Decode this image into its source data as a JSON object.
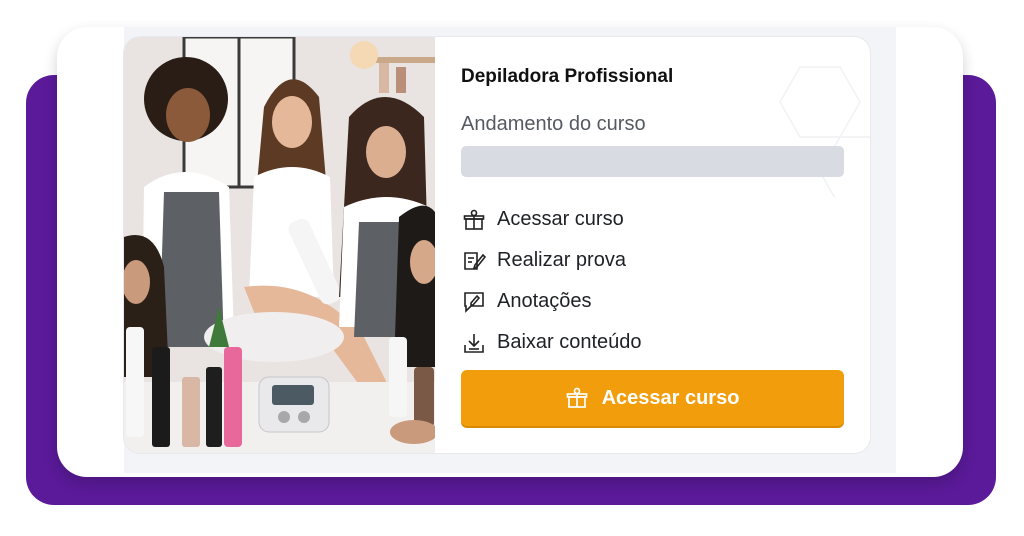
{
  "course": {
    "title": "Depiladora Profissional",
    "progress_label": "Andamento do curso",
    "progress_value": 0,
    "thumbnail_icon": "course-photo-hair-removal-class"
  },
  "menu": [
    {
      "label": "Acessar curso",
      "icon": "gift-box-icon"
    },
    {
      "label": "Realizar prova",
      "icon": "edit-document-icon"
    },
    {
      "label": "Anotações",
      "icon": "note-pencil-icon"
    },
    {
      "label": "Baixar conteúdo",
      "icon": "download-tray-icon"
    }
  ],
  "cta": {
    "label": "Acessar curso",
    "icon": "gift-box-icon"
  },
  "colors": {
    "accent": "#f29e0c",
    "frame_purple": "#5b1a99",
    "progress_track": "#d8dce2"
  }
}
